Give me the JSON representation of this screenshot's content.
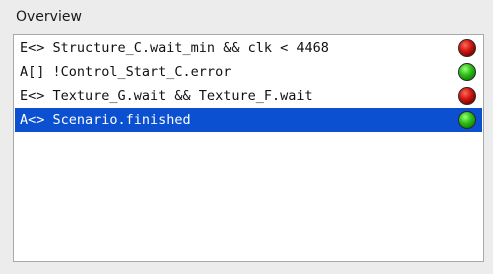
{
  "panel": {
    "title": "Overview"
  },
  "queries": [
    {
      "text": "E<> Structure_C.wait_min && clk < 4468",
      "status": "red",
      "status_color": "#c0140c",
      "selected": false
    },
    {
      "text": "A[] !Control_Start_C.error",
      "status": "green",
      "status_color": "#22b012",
      "selected": false
    },
    {
      "text": "E<> Texture_G.wait && Texture_F.wait",
      "status": "red",
      "status_color": "#c0140c",
      "selected": false
    },
    {
      "text": "A<> Scenario.finished",
      "status": "green",
      "status_color": "#22b012",
      "selected": true
    }
  ],
  "colors": {
    "selection": "#0b50d0",
    "panel_background": "#ececec",
    "list_background": "#ffffff"
  }
}
